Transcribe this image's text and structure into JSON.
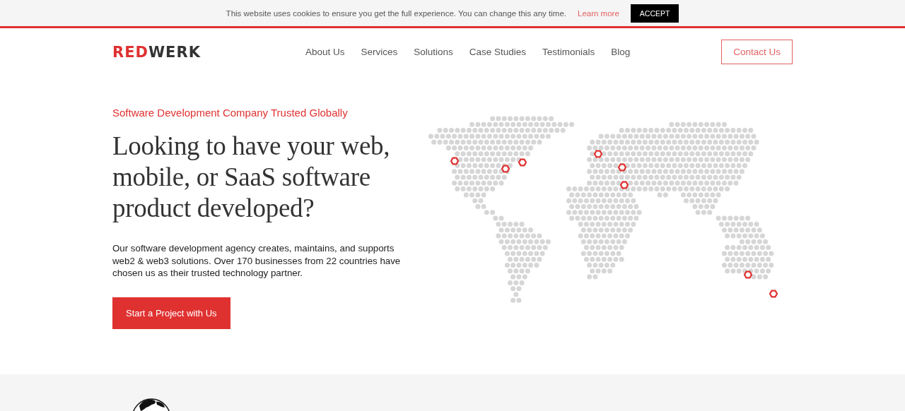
{
  "cookie_bar": {
    "message": "This website uses cookies to ensure you get the full experience. You can change this any time.",
    "link": "Learn more",
    "button": "ACCEPT"
  },
  "header": {
    "logo": {
      "part_1": "RED",
      "part_2": "WERK"
    },
    "nav": [
      {
        "label": "About Us"
      },
      {
        "label": "Services"
      },
      {
        "label": "Solutions"
      },
      {
        "label": "Case Studies"
      },
      {
        "label": "Testimonials"
      },
      {
        "label": "Blog"
      }
    ],
    "cta": "Contact Us"
  },
  "hero": {
    "eyebrow": "Software Development Company Trusted Globally",
    "heading": "Looking to have your web, mobile, or SaaS software product developed?",
    "body": "Our software development agency creates, maintains, and supports web2 & web3 solutions. Over 170 businesses from 22 countries have chosen us as their trusted technology partner.",
    "button": "Start a Project with Us"
  }
}
